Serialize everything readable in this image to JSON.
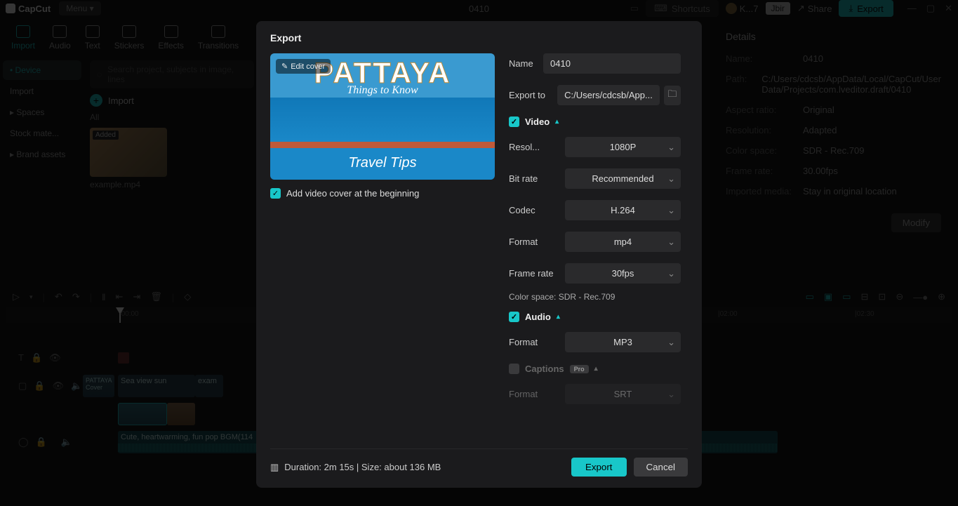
{
  "topbar": {
    "app_name": "CapCut",
    "menu_label": "Menu ▾",
    "project_title": "0410",
    "shortcuts_label": "Shortcuts",
    "user_label": "K...7",
    "jbir_label": "Jbir",
    "share_label": "Share",
    "export_label": "Export"
  },
  "tabs": [
    {
      "label": "Import",
      "active": true
    },
    {
      "label": "Audio"
    },
    {
      "label": "Text"
    },
    {
      "label": "Stickers"
    },
    {
      "label": "Effects"
    },
    {
      "label": "Transitions"
    }
  ],
  "side": [
    {
      "label": "• Device",
      "active": true
    },
    {
      "label": "Import"
    },
    {
      "label": "▸ Spaces"
    },
    {
      "label": "Stock mate..."
    },
    {
      "label": "▸ Brand assets"
    }
  ],
  "media": {
    "search_placeholder": "Search project, subjects in image, lines",
    "import_label": "Import",
    "filter_all": "All",
    "thumb_badge": "Added",
    "thumb_name": "example.mp4"
  },
  "details": {
    "heading": "Details",
    "rows": [
      {
        "lab": "Name:",
        "val": "0410"
      },
      {
        "lab": "Path:",
        "val": "C:/Users/cdcsb/AppData/Local/CapCut/User Data/Projects/com.lveditor.draft/0410"
      },
      {
        "lab": "Aspect ratio:",
        "val": "Original"
      },
      {
        "lab": "Resolution:",
        "val": "Adapted"
      },
      {
        "lab": "Color space:",
        "val": "SDR - Rec.709"
      },
      {
        "lab": "Frame rate:",
        "val": "30.00fps"
      },
      {
        "lab": "Imported media:",
        "val": "Stay in original location"
      }
    ],
    "modify_label": "Modify"
  },
  "timeline": {
    "ruler_marks": [
      "|00:00",
      "|02:00",
      "|02:30"
    ],
    "textclip": "Sea view sun",
    "textclip2": "exam",
    "overlayclip": "PATTAYA\nCover",
    "audioclip": "Cute, heartwarming, fun pop BGM(114"
  },
  "modal": {
    "title": "Export",
    "edit_cover": "Edit cover",
    "cover_title": "PATTAYA",
    "cover_sub": "Things to Know",
    "cover_bottom": "Travel Tips",
    "add_cover_label": "Add video cover at the beginning",
    "name_label": "Name",
    "name_value": "0410",
    "exportto_label": "Export to",
    "exportto_value": "C:/Users/cdcsb/App...",
    "video_section": "Video",
    "resolution_label": "Resol...",
    "resolution_value": "1080P",
    "bitrate_label": "Bit rate",
    "bitrate_value": "Recommended",
    "codec_label": "Codec",
    "codec_value": "H.264",
    "format_label": "Format",
    "format_value": "mp4",
    "framerate_label": "Frame rate",
    "framerate_value": "30fps",
    "colorspace_note": "Color space: SDR - Rec.709",
    "audio_section": "Audio",
    "audio_format_label": "Format",
    "audio_format_value": "MP3",
    "captions_section": "Captions",
    "captions_format_label": "Format",
    "captions_format_value": "SRT",
    "pro": "Pro",
    "footer_info": "Duration: 2m 15s | Size: about 136 MB",
    "export_label": "Export",
    "cancel_label": "Cancel"
  }
}
